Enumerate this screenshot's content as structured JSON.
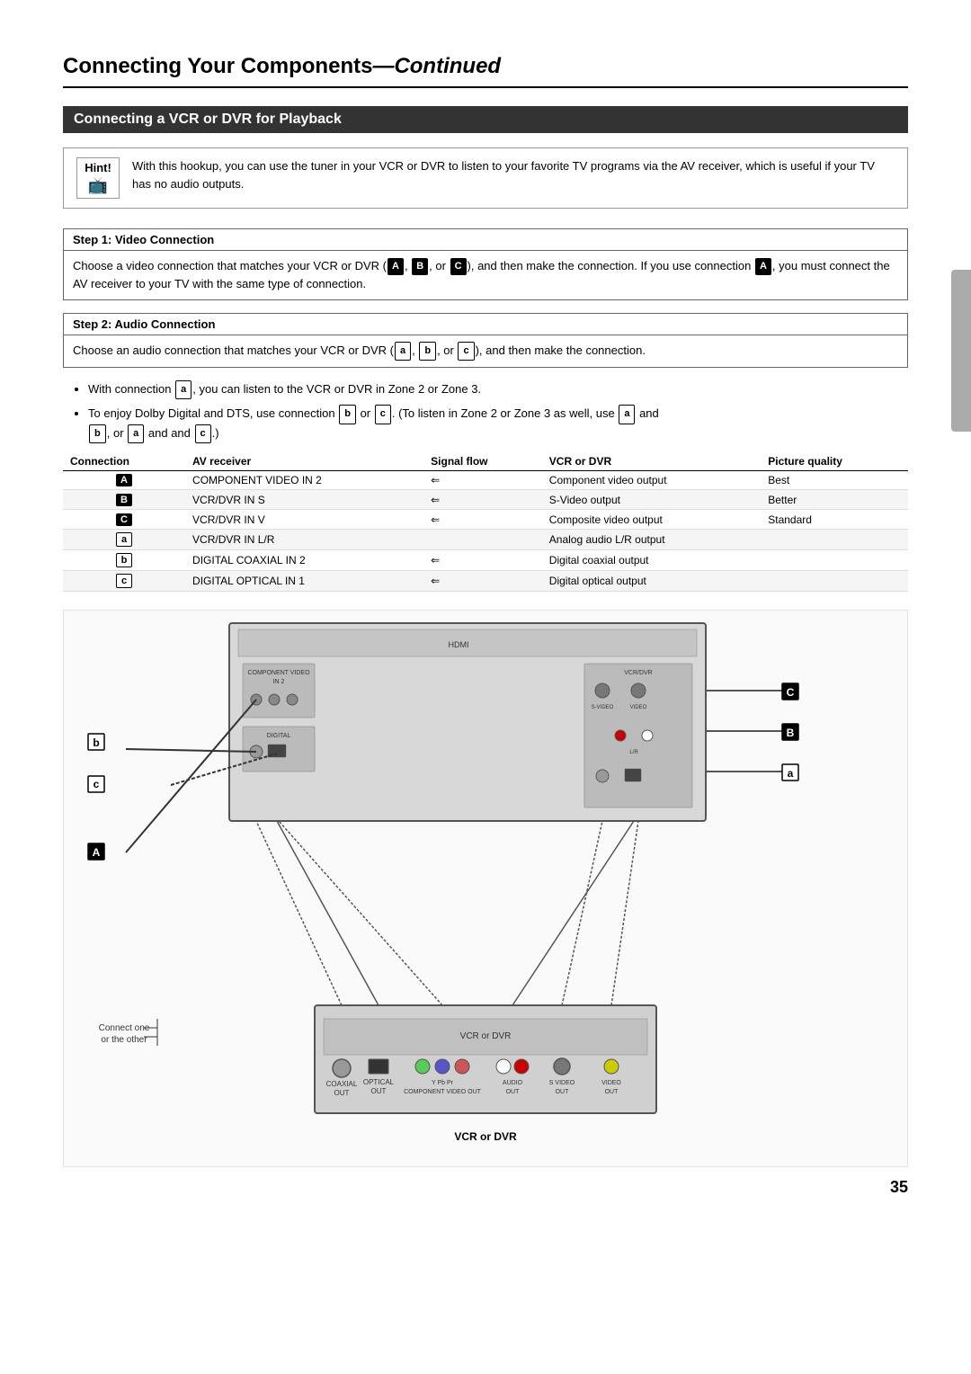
{
  "page": {
    "title_main": "Connecting Your Components",
    "title_italic": "Continued",
    "page_number": "35"
  },
  "section": {
    "header": "Connecting a VCR or DVR for Playback"
  },
  "hint": {
    "label": "Hint!",
    "text": "With this hookup, you can use the tuner in your VCR or DVR to listen to your favorite TV programs via the AV receiver, which is useful if your TV has no audio outputs."
  },
  "step1": {
    "title": "Step 1: Video Connection",
    "body": "Choose a video connection that matches your VCR or DVR (",
    "body2": "), and then make the connection. If you use connection ",
    "body3": ", you must connect the AV receiver to your TV with the same type of connection.",
    "badge_A": "A",
    "badge_B": "B",
    "badge_C": "C",
    "badge_A2": "A"
  },
  "step2": {
    "title": "Step 2: Audio Connection",
    "body": "Choose an audio connection that matches your VCR or DVR (",
    "body2": "), and then make the connection.",
    "badge_a": "a",
    "badge_b": "b",
    "badge_c": "c"
  },
  "bullets": [
    {
      "text1": "With connection ",
      "badge": "a",
      "text2": ", you can listen to the VCR or DVR in Zone 2 or Zone 3."
    },
    {
      "text1": "To enjoy Dolby Digital and DTS, use connection ",
      "badge_b": "b",
      "text2": " or ",
      "badge_c": "c",
      "text3": ". (To listen in Zone 2 or Zone 3 as well, use ",
      "badge_a": "a",
      "text4": " and ",
      "text5": ", or ",
      "badge_a2": "a",
      "text6": " and ",
      "badge_c2": "c",
      "text7": ".)"
    }
  ],
  "table": {
    "headers": [
      "Connection",
      "AV receiver",
      "Signal flow",
      "VCR or DVR",
      "Picture quality"
    ],
    "rows": [
      {
        "connection": "A",
        "av_receiver": "COMPONENT VIDEO IN 2",
        "signal_flow": "⇐",
        "vcr_dvr": "Component video output",
        "quality": "Best",
        "badge_type": "black"
      },
      {
        "connection": "B",
        "av_receiver": "VCR/DVR IN S",
        "signal_flow": "⇐",
        "vcr_dvr": "S-Video output",
        "quality": "Better",
        "badge_type": "black"
      },
      {
        "connection": "C",
        "av_receiver": "VCR/DVR IN V",
        "signal_flow": "⇐",
        "vcr_dvr": "Composite video output",
        "quality": "Standard",
        "badge_type": "black"
      },
      {
        "connection": "a",
        "av_receiver": "VCR/DVR IN L/R",
        "signal_flow": "",
        "vcr_dvr": "Analog audio L/R output",
        "quality": "",
        "badge_type": "outline"
      },
      {
        "connection": "b",
        "av_receiver": "DIGITAL COAXIAL IN 2",
        "signal_flow": "⇐",
        "vcr_dvr": "Digital coaxial output",
        "quality": "",
        "badge_type": "outline"
      },
      {
        "connection": "c",
        "av_receiver": "DIGITAL OPTICAL IN 1",
        "signal_flow": "⇐",
        "vcr_dvr": "Digital optical output",
        "quality": "",
        "badge_type": "outline"
      }
    ]
  },
  "diagram": {
    "labels": {
      "b_left": "b",
      "c_left": "c",
      "A_left": "A",
      "C_right": "C",
      "B_right": "B",
      "a_right": "a",
      "vcr_dvr": "VCR or DVR",
      "connect_note": "Connect one\nor the other"
    }
  }
}
